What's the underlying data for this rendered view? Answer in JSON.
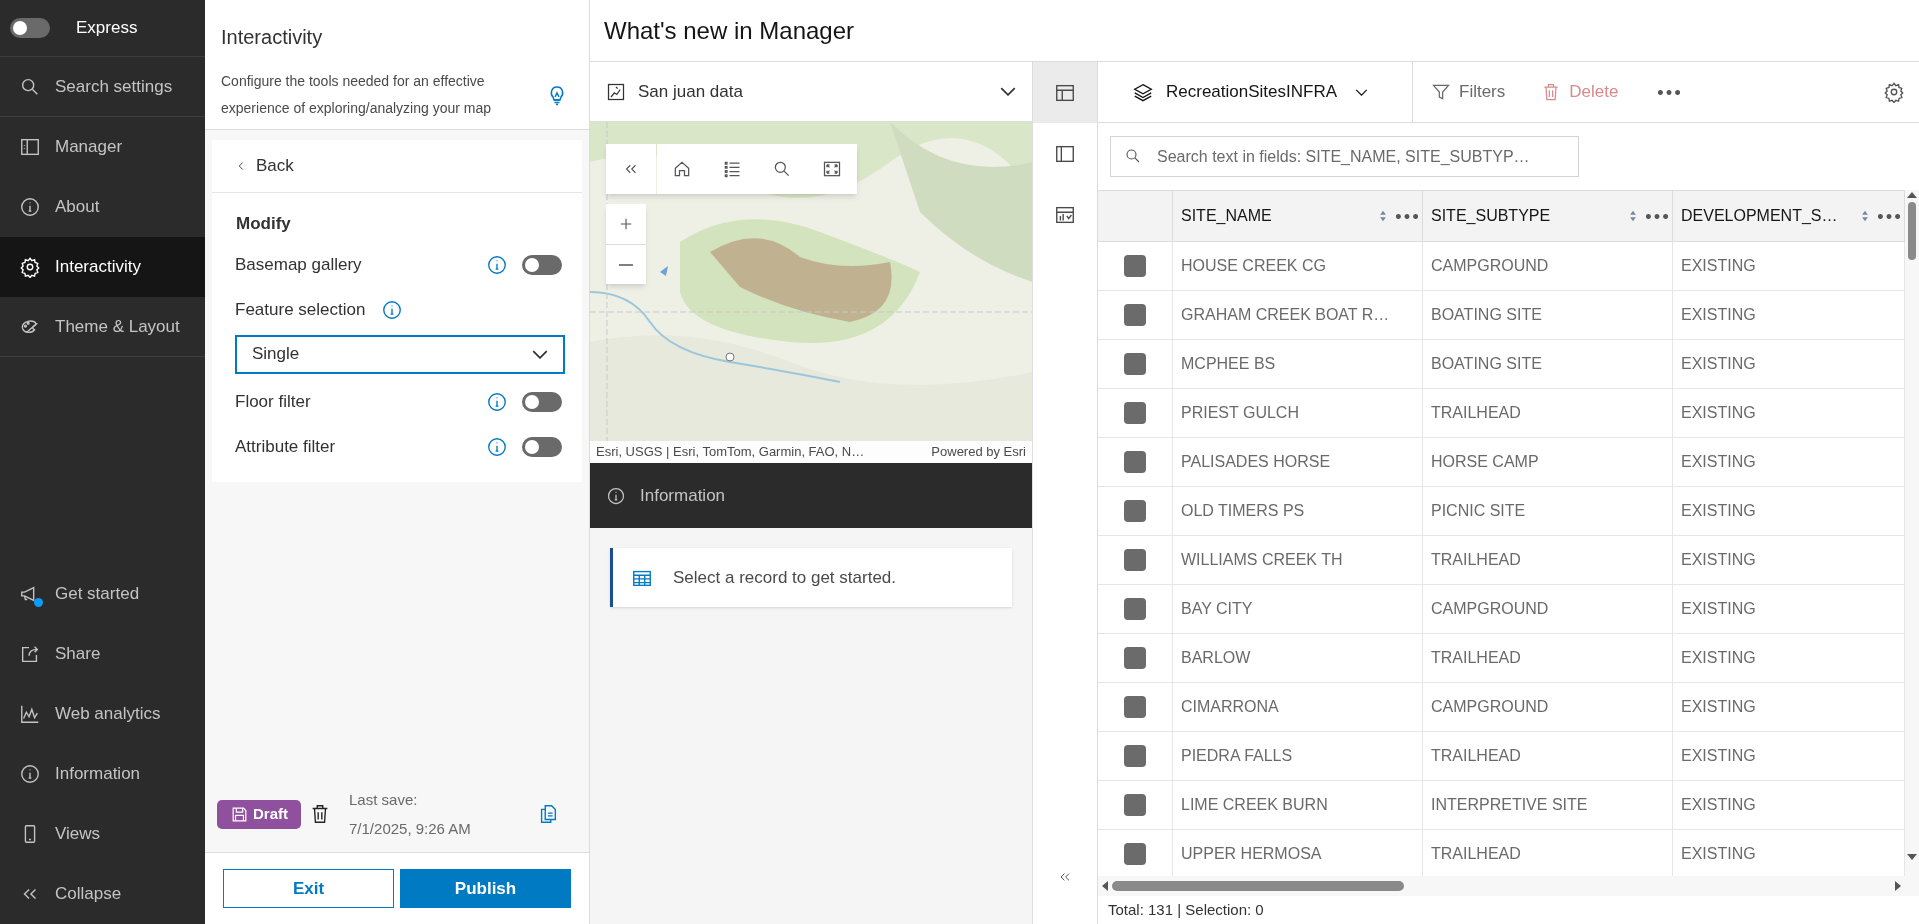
{
  "sidebar": {
    "mode_toggle": {
      "label": "Express",
      "on": false
    },
    "items": [
      {
        "label": "Search settings",
        "selected": false
      },
      {
        "label": "Manager",
        "selected": false
      },
      {
        "label": "About",
        "selected": false
      },
      {
        "label": "Interactivity",
        "selected": true
      },
      {
        "label": "Theme & Layout",
        "selected": false
      }
    ],
    "bottom_items": [
      {
        "label": "Get started",
        "notification": true
      },
      {
        "label": "Share",
        "notification": false
      },
      {
        "label": "Web analytics",
        "notification": false
      },
      {
        "label": "Information",
        "notification": false
      },
      {
        "label": "Views",
        "notification": false
      },
      {
        "label": "Collapse",
        "notification": false
      }
    ]
  },
  "settings_panel": {
    "title": "Interactivity",
    "description": "Configure the tools needed for an effective experience of exploring/analyzing your map",
    "back": "Back",
    "section": "Modify",
    "settings": [
      {
        "kind": "toggle",
        "label": "Basemap gallery",
        "on": false
      },
      {
        "kind": "select",
        "label": "Feature selection",
        "value": "Single"
      },
      {
        "kind": "toggle",
        "label": "Floor filter",
        "on": false
      },
      {
        "kind": "toggle",
        "label": "Attribute filter",
        "on": false
      }
    ],
    "status": "Draft",
    "last_save_label": "Last save:",
    "last_save_time": "7/1/2025, 9:26 AM",
    "buttons": [
      {
        "kind": "secondary",
        "label": "Exit"
      },
      {
        "kind": "primary",
        "label": "Publish"
      }
    ]
  },
  "main": {
    "title": "What's new in Manager"
  },
  "map_panel": {
    "map_select": "San juan data",
    "attribution": "Esri, USGS | Esri, TomTom, Garmin, FAO, N…",
    "powered_by": "Powered by Esri",
    "info_header": "Information",
    "info_message": "Select a record to get started."
  },
  "table_panel": {
    "rail": [
      {
        "selected": true
      },
      {
        "selected": false
      },
      {
        "selected": false
      }
    ],
    "layer": "RecreationSitesINFRA",
    "actions": [
      {
        "label": "Filters",
        "disabled": false
      },
      {
        "label": "Delete",
        "disabled": true
      }
    ],
    "search": {
      "placeholder": "Search text in fields: SITE_NAME, SITE_SUBTYP…"
    },
    "columns": [
      "SITE_NAME",
      "SITE_SUBTYPE",
      "DEVELOPMENT_S…"
    ],
    "rows": [
      {
        "selected": false,
        "cells": [
          "HOUSE CREEK CG",
          "CAMPGROUND",
          "EXISTING"
        ]
      },
      {
        "selected": false,
        "cells": [
          "GRAHAM CREEK BOAT R…",
          "BOATING SITE",
          "EXISTING"
        ]
      },
      {
        "selected": false,
        "cells": [
          "MCPHEE BS",
          "BOATING SITE",
          "EXISTING"
        ]
      },
      {
        "selected": false,
        "cells": [
          "PRIEST GULCH",
          "TRAILHEAD",
          "EXISTING"
        ]
      },
      {
        "selected": false,
        "cells": [
          "PALISADES HORSE",
          "HORSE CAMP",
          "EXISTING"
        ]
      },
      {
        "selected": false,
        "cells": [
          "OLD TIMERS PS",
          "PICNIC SITE",
          "EXISTING"
        ]
      },
      {
        "selected": false,
        "cells": [
          "WILLIAMS CREEK TH",
          "TRAILHEAD",
          "EXISTING"
        ]
      },
      {
        "selected": false,
        "cells": [
          "BAY CITY",
          "CAMPGROUND",
          "EXISTING"
        ]
      },
      {
        "selected": false,
        "cells": [
          "BARLOW",
          "TRAILHEAD",
          "EXISTING"
        ]
      },
      {
        "selected": false,
        "cells": [
          "CIMARRONA",
          "CAMPGROUND",
          "EXISTING"
        ]
      },
      {
        "selected": false,
        "cells": [
          "PIEDRA FALLS",
          "TRAILHEAD",
          "EXISTING"
        ]
      },
      {
        "selected": false,
        "cells": [
          "LIME CREEK BURN",
          "INTERPRETIVE SITE",
          "EXISTING"
        ]
      },
      {
        "selected": false,
        "cells": [
          "UPPER HERMOSA",
          "TRAILHEAD",
          "EXISTING"
        ]
      }
    ],
    "footer": "Total: 131 | Selection: 0"
  }
}
